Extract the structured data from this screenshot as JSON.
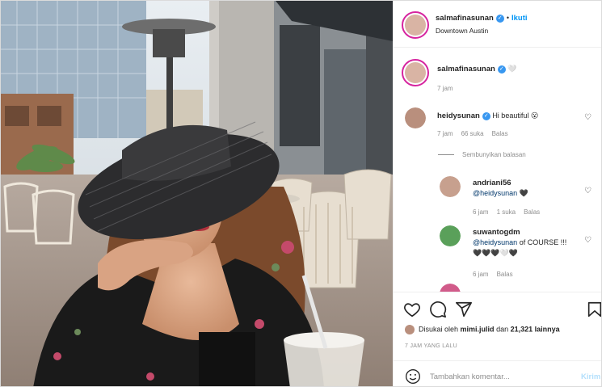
{
  "post": {
    "username": "salmafinasunan",
    "verified_mark": "✓",
    "dot": "•",
    "follow_label": "Ikuti",
    "location": "Downtown Austin"
  },
  "caption": {
    "username": "salmafinasunan",
    "text": "🤍",
    "time": "7 jam"
  },
  "comments": [
    {
      "username": "heidysunan",
      "text": "Hi beautiful 😮",
      "time": "7 jam",
      "likes": "66 suka",
      "reply": "Balas"
    }
  ],
  "hide_replies_label": "Sembunyikan balasan",
  "replies": [
    {
      "username": "andriani56",
      "mention": "@heidysunan",
      "text": " 🖤",
      "time": "6 jam",
      "likes": "1 suka",
      "reply": "Balas"
    },
    {
      "username": "suwantogdm",
      "mention": "@heidysunan",
      "text": " of COURSE !!! 🖤🖤🖤🤍🖤",
      "time": "6 jam",
      "reply": "Balas"
    }
  ],
  "likes": {
    "prefix": "Disukai oleh",
    "user": "mimi.julid",
    "middle": "dan",
    "count": "21,321 lainnya"
  },
  "timeago": "7 JAM YANG LALU",
  "add_comment": {
    "placeholder": "Tambahkan komentar...",
    "send": "Kirim"
  },
  "icons": {
    "heart": "heart-icon",
    "comment": "comment-icon",
    "share": "share-icon",
    "bookmark": "bookmark-icon",
    "emoji": "emoji-icon"
  },
  "colors": {
    "accent": "#0095f6",
    "verified": "#3897f0",
    "muted": "#8e8e8e"
  }
}
